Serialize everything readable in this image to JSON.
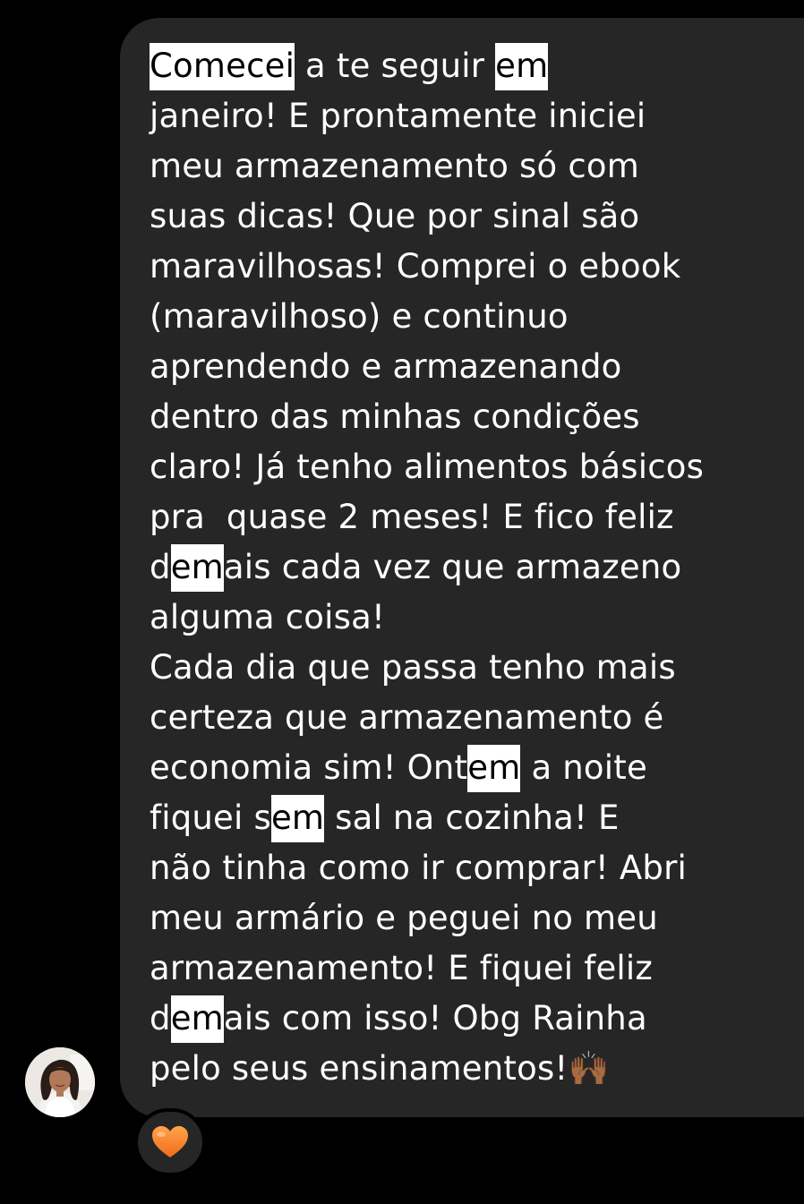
{
  "message": {
    "lines": [
      [
        {
          "t": "Comecei",
          "hl": true
        },
        {
          "t": " a te seguir "
        },
        {
          "t": "em",
          "hl": true
        }
      ],
      [
        {
          "t": "janeiro! E prontamente iniciei"
        }
      ],
      [
        {
          "t": "meu armazenamento só com"
        }
      ],
      [
        {
          "t": "suas dicas! Que por sinal são"
        }
      ],
      [
        {
          "t": "maravilhosas! Comprei o ebook"
        }
      ],
      [
        {
          "t": "(maravilhoso) e continuo"
        }
      ],
      [
        {
          "t": "aprendendo e armazenando"
        }
      ],
      [
        {
          "t": "dentro das minhas condições"
        }
      ],
      [
        {
          "t": "claro! Já tenho alimentos básicos"
        }
      ],
      [
        {
          "t": "pra  quase 2 meses! E fico feliz"
        }
      ],
      [
        {
          "t": "d"
        },
        {
          "t": "em",
          "hl": true
        },
        {
          "t": "ais cada vez que armazeno"
        }
      ],
      [
        {
          "t": "alguma coisa!"
        }
      ],
      [
        {
          "t": "Cada dia que passa tenho mais"
        }
      ],
      [
        {
          "t": "certeza que armazenamento é"
        }
      ],
      [
        {
          "t": "economia sim! Ont"
        },
        {
          "t": "em",
          "hl": true
        },
        {
          "t": " a noite"
        }
      ],
      [
        {
          "t": "fiquei s"
        },
        {
          "t": "em",
          "hl": true
        },
        {
          "t": " sal na cozinha! E"
        }
      ],
      [
        {
          "t": "não tinha como ir comprar! Abri"
        }
      ],
      [
        {
          "t": "meu armário e peguei no meu"
        }
      ],
      [
        {
          "t": "armazenamento! E fiquei feliz"
        }
      ],
      [
        {
          "t": "d"
        },
        {
          "t": "em",
          "hl": true
        },
        {
          "t": "ais com isso! Obg Rainha"
        }
      ],
      [
        {
          "t": "pelo seus ensinamentos!🙌🏾"
        }
      ]
    ]
  },
  "avatar": {
    "icon": "profile-photo"
  },
  "reaction": {
    "emoji": "🧡",
    "icon": "orange-heart-icon"
  },
  "colors": {
    "background": "#000000",
    "bubble": "#262626",
    "text": "#ffffff",
    "highlight_bg": "#ffffff",
    "highlight_text": "#000000",
    "heart": "#f7852a"
  }
}
